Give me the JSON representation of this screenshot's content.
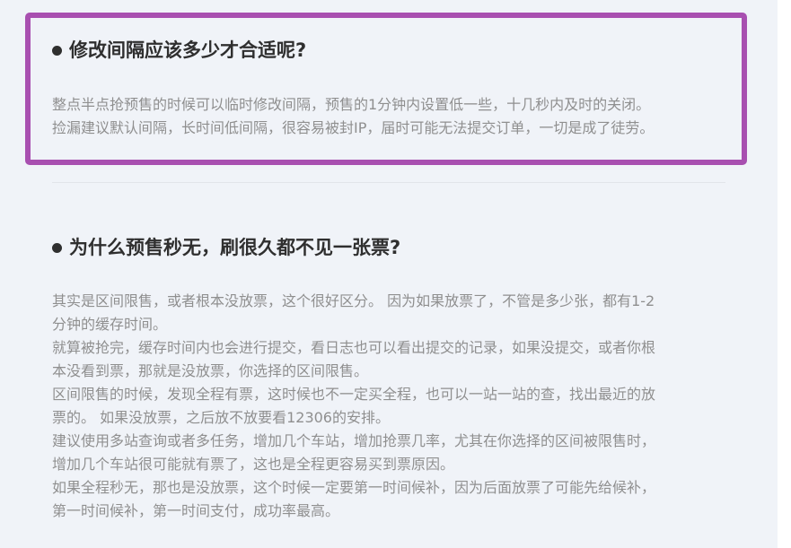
{
  "sections": [
    {
      "title": "修改间隔应该多少才合适呢?",
      "lines": [
        "整点半点抢预售的时候可以临时修改间隔，预售的1分钟内设置低一些，十几秒内及时的关闭。",
        "捡漏建议默认间隔，长时间低间隔，很容易被封IP，届时可能无法提交订单，一切是成了徒劳。"
      ]
    },
    {
      "title": "为什么预售秒无，刷很久都不见一张票?",
      "lines": [
        "其实是区间限售，或者根本没放票，这个很好区分。 因为如果放票了，不管是多少张，都有1-2",
        "分钟的缓存时间。",
        "就算被抢完，缓存时间内也会进行提交，看日志也可以看出提交的记录，如果没提交，或者你根",
        "本没看到票，那就是没放票，你选择的区间限售。",
        "区间限售的时候，发现全程有票，这时候也不一定买全程，也可以一站一站的查，找出最近的放",
        "票的。 如果没放票，之后放不放要看12306的安排。",
        "建议使用多站查询或者多任务，增加几个车站，增加抢票几率，尤其在你选择的区间被限售时，",
        "增加几个车站很可能就有票了，这也是全程更容易买到票原因。",
        "如果全程秒无，那也是没放票，这个时候一定要第一时间候补，因为后面放票了可能先给候补，",
        "第一时间候补，第一时间支付，成功率最高。"
      ]
    }
  ],
  "colors": {
    "highlight_border": "#a84fb0",
    "background": "#f0f3f8",
    "heading_text": "#2f2f2f",
    "body_text": "#8f8f8f"
  },
  "icons": {
    "bullet": "bullet-dot-icon"
  }
}
